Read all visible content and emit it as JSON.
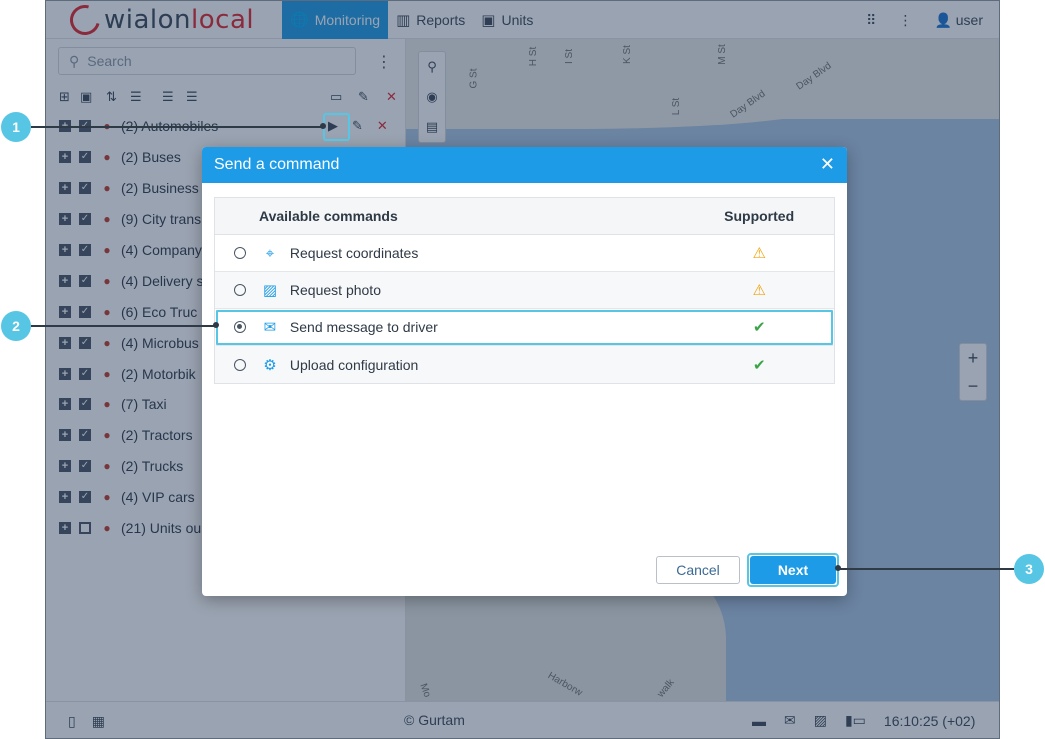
{
  "header": {
    "logo_main": "wialon",
    "logo_accent": "local",
    "tabs": [
      {
        "label": "Monitoring",
        "icon": "globe-icon"
      },
      {
        "label": "Reports",
        "icon": "reports-icon"
      },
      {
        "label": "Units",
        "icon": "bus-icon"
      }
    ],
    "user": "user"
  },
  "sidebar": {
    "search_placeholder": "Search",
    "groups": [
      {
        "label": "(2) Automobiles"
      },
      {
        "label": "(2) Buses"
      },
      {
        "label": "(2) Business"
      },
      {
        "label": "(9) City trans"
      },
      {
        "label": "(4) Company"
      },
      {
        "label": "(4) Delivery s"
      },
      {
        "label": "(6) Eco Truc"
      },
      {
        "label": "(4) Microbus"
      },
      {
        "label": "(2) Motorbik"
      },
      {
        "label": "(7) Taxi"
      },
      {
        "label": "(2) Tractors"
      },
      {
        "label": "(2) Trucks"
      },
      {
        "label": "(4) VIP cars"
      },
      {
        "label": "(21) Units ou"
      }
    ]
  },
  "map": {
    "streets": [
      "G St",
      "H St",
      "I St",
      "K St",
      "M St",
      "L St",
      "Day Blvd",
      "Day Blvd",
      "Harborw",
      "walk",
      "Mo"
    ]
  },
  "dialog": {
    "title": "Send a command",
    "col_commands": "Available commands",
    "col_supported": "Supported",
    "commands": [
      {
        "label": "Request coordinates",
        "icon": "crosshair-icon",
        "supported": "partial"
      },
      {
        "label": "Request photo",
        "icon": "image-icon",
        "supported": "partial"
      },
      {
        "label": "Send message to driver",
        "icon": "message-icon",
        "supported": "yes",
        "selected": true
      },
      {
        "label": "Upload configuration",
        "icon": "gear-upload-icon",
        "supported": "yes"
      }
    ],
    "cancel": "Cancel",
    "next": "Next"
  },
  "footer": {
    "copyright": "© Gurtam",
    "time": "16:10:25 (+02)"
  },
  "callouts": [
    "1",
    "2",
    "3"
  ]
}
